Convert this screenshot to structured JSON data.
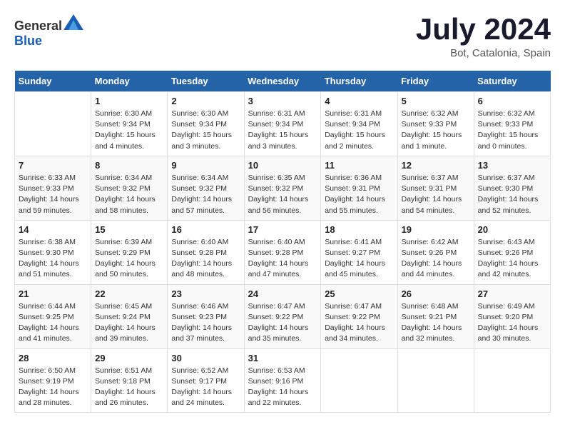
{
  "header": {
    "logo": {
      "general": "General",
      "blue": "Blue"
    },
    "month": "July 2024",
    "location": "Bot, Catalonia, Spain"
  },
  "weekdays": [
    "Sunday",
    "Monday",
    "Tuesday",
    "Wednesday",
    "Thursday",
    "Friday",
    "Saturday"
  ],
  "weeks": [
    [
      {
        "day": "",
        "info": ""
      },
      {
        "day": "1",
        "info": "Sunrise: 6:30 AM\nSunset: 9:34 PM\nDaylight: 15 hours\nand 4 minutes."
      },
      {
        "day": "2",
        "info": "Sunrise: 6:30 AM\nSunset: 9:34 PM\nDaylight: 15 hours\nand 3 minutes."
      },
      {
        "day": "3",
        "info": "Sunrise: 6:31 AM\nSunset: 9:34 PM\nDaylight: 15 hours\nand 3 minutes."
      },
      {
        "day": "4",
        "info": "Sunrise: 6:31 AM\nSunset: 9:34 PM\nDaylight: 15 hours\nand 2 minutes."
      },
      {
        "day": "5",
        "info": "Sunrise: 6:32 AM\nSunset: 9:33 PM\nDaylight: 15 hours\nand 1 minute."
      },
      {
        "day": "6",
        "info": "Sunrise: 6:32 AM\nSunset: 9:33 PM\nDaylight: 15 hours\nand 0 minutes."
      }
    ],
    [
      {
        "day": "7",
        "info": "Sunrise: 6:33 AM\nSunset: 9:33 PM\nDaylight: 14 hours\nand 59 minutes."
      },
      {
        "day": "8",
        "info": "Sunrise: 6:34 AM\nSunset: 9:32 PM\nDaylight: 14 hours\nand 58 minutes."
      },
      {
        "day": "9",
        "info": "Sunrise: 6:34 AM\nSunset: 9:32 PM\nDaylight: 14 hours\nand 57 minutes."
      },
      {
        "day": "10",
        "info": "Sunrise: 6:35 AM\nSunset: 9:32 PM\nDaylight: 14 hours\nand 56 minutes."
      },
      {
        "day": "11",
        "info": "Sunrise: 6:36 AM\nSunset: 9:31 PM\nDaylight: 14 hours\nand 55 minutes."
      },
      {
        "day": "12",
        "info": "Sunrise: 6:37 AM\nSunset: 9:31 PM\nDaylight: 14 hours\nand 54 minutes."
      },
      {
        "day": "13",
        "info": "Sunrise: 6:37 AM\nSunset: 9:30 PM\nDaylight: 14 hours\nand 52 minutes."
      }
    ],
    [
      {
        "day": "14",
        "info": "Sunrise: 6:38 AM\nSunset: 9:30 PM\nDaylight: 14 hours\nand 51 minutes."
      },
      {
        "day": "15",
        "info": "Sunrise: 6:39 AM\nSunset: 9:29 PM\nDaylight: 14 hours\nand 50 minutes."
      },
      {
        "day": "16",
        "info": "Sunrise: 6:40 AM\nSunset: 9:28 PM\nDaylight: 14 hours\nand 48 minutes."
      },
      {
        "day": "17",
        "info": "Sunrise: 6:40 AM\nSunset: 9:28 PM\nDaylight: 14 hours\nand 47 minutes."
      },
      {
        "day": "18",
        "info": "Sunrise: 6:41 AM\nSunset: 9:27 PM\nDaylight: 14 hours\nand 45 minutes."
      },
      {
        "day": "19",
        "info": "Sunrise: 6:42 AM\nSunset: 9:26 PM\nDaylight: 14 hours\nand 44 minutes."
      },
      {
        "day": "20",
        "info": "Sunrise: 6:43 AM\nSunset: 9:26 PM\nDaylight: 14 hours\nand 42 minutes."
      }
    ],
    [
      {
        "day": "21",
        "info": "Sunrise: 6:44 AM\nSunset: 9:25 PM\nDaylight: 14 hours\nand 41 minutes."
      },
      {
        "day": "22",
        "info": "Sunrise: 6:45 AM\nSunset: 9:24 PM\nDaylight: 14 hours\nand 39 minutes."
      },
      {
        "day": "23",
        "info": "Sunrise: 6:46 AM\nSunset: 9:23 PM\nDaylight: 14 hours\nand 37 minutes."
      },
      {
        "day": "24",
        "info": "Sunrise: 6:47 AM\nSunset: 9:22 PM\nDaylight: 14 hours\nand 35 minutes."
      },
      {
        "day": "25",
        "info": "Sunrise: 6:47 AM\nSunset: 9:22 PM\nDaylight: 14 hours\nand 34 minutes."
      },
      {
        "day": "26",
        "info": "Sunrise: 6:48 AM\nSunset: 9:21 PM\nDaylight: 14 hours\nand 32 minutes."
      },
      {
        "day": "27",
        "info": "Sunrise: 6:49 AM\nSunset: 9:20 PM\nDaylight: 14 hours\nand 30 minutes."
      }
    ],
    [
      {
        "day": "28",
        "info": "Sunrise: 6:50 AM\nSunset: 9:19 PM\nDaylight: 14 hours\nand 28 minutes."
      },
      {
        "day": "29",
        "info": "Sunrise: 6:51 AM\nSunset: 9:18 PM\nDaylight: 14 hours\nand 26 minutes."
      },
      {
        "day": "30",
        "info": "Sunrise: 6:52 AM\nSunset: 9:17 PM\nDaylight: 14 hours\nand 24 minutes."
      },
      {
        "day": "31",
        "info": "Sunrise: 6:53 AM\nSunset: 9:16 PM\nDaylight: 14 hours\nand 22 minutes."
      },
      {
        "day": "",
        "info": ""
      },
      {
        "day": "",
        "info": ""
      },
      {
        "day": "",
        "info": ""
      }
    ]
  ]
}
